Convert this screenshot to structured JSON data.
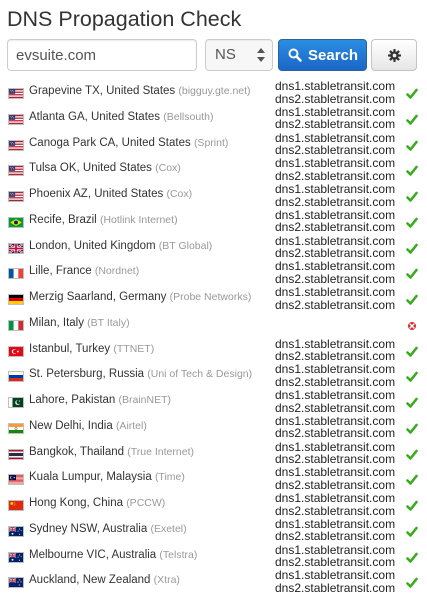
{
  "page": {
    "title": "DNS Propagation Check"
  },
  "search": {
    "domain_value": "evsuite.com",
    "record_type": "NS",
    "search_label": "Search"
  },
  "colors": {
    "check": "#3aab1f",
    "error": "#d32f2f",
    "isp": "#999999",
    "primary": "#2279d2"
  },
  "results": [
    {
      "flag": "us",
      "location": "Grapevine TX, United States",
      "isp": "(bigguy.gte.net)",
      "ns": [
        "dns1.stabletransit.com",
        "dns2.stabletransit.com"
      ],
      "status": "ok",
      "status_icon": "check-icon"
    },
    {
      "flag": "us",
      "location": "Atlanta GA, United States",
      "isp": "(Bellsouth)",
      "ns": [
        "dns1.stabletransit.com",
        "dns2.stabletransit.com"
      ],
      "status": "ok",
      "status_icon": "check-icon"
    },
    {
      "flag": "us",
      "location": "Canoga Park CA, United States",
      "isp": "(Sprint)",
      "ns": [
        "dns1.stabletransit.com",
        "dns2.stabletransit.com"
      ],
      "status": "ok",
      "status_icon": "check-icon"
    },
    {
      "flag": "us",
      "location": "Tulsa OK, United States",
      "isp": "(Cox)",
      "ns": [
        "dns1.stabletransit.com",
        "dns2.stabletransit.com"
      ],
      "status": "ok",
      "status_icon": "check-icon"
    },
    {
      "flag": "us",
      "location": "Phoenix AZ, United States",
      "isp": "(Cox)",
      "ns": [
        "dns1.stabletransit.com",
        "dns2.stabletransit.com"
      ],
      "status": "ok",
      "status_icon": "check-icon"
    },
    {
      "flag": "br",
      "location": "Recife, Brazil",
      "isp": "(Hotlink Internet)",
      "ns": [
        "dns1.stabletransit.com",
        "dns2.stabletransit.com"
      ],
      "status": "ok",
      "status_icon": "check-icon"
    },
    {
      "flag": "gb",
      "location": "London, United Kingdom",
      "isp": "(BT Global)",
      "ns": [
        "dns1.stabletransit.com",
        "dns2.stabletransit.com"
      ],
      "status": "ok",
      "status_icon": "check-icon"
    },
    {
      "flag": "fr",
      "location": "Lille, France",
      "isp": "(Nordnet)",
      "ns": [
        "dns1.stabletransit.com",
        "dns2.stabletransit.com"
      ],
      "status": "ok",
      "status_icon": "check-icon"
    },
    {
      "flag": "de",
      "location": "Merzig Saarland, Germany",
      "isp": "(Probe Networks)",
      "ns": [
        "dns1.stabletransit.com",
        "dns2.stabletransit.com"
      ],
      "status": "ok",
      "status_icon": "check-icon"
    },
    {
      "flag": "it",
      "location": "Milan, Italy",
      "isp": "(BT Italy)",
      "ns": [],
      "status": "error",
      "status_icon": "error-icon"
    },
    {
      "flag": "tr",
      "location": "Istanbul, Turkey",
      "isp": "(TTNET)",
      "ns": [
        "dns1.stabletransit.com",
        "dns2.stabletransit.com"
      ],
      "status": "ok",
      "status_icon": "check-icon"
    },
    {
      "flag": "ru",
      "location": "St. Petersburg, Russia",
      "isp": "(Uni of Tech & Design)",
      "ns": [
        "dns1.stabletransit.com",
        "dns2.stabletransit.com"
      ],
      "status": "ok",
      "status_icon": "check-icon"
    },
    {
      "flag": "pk",
      "location": "Lahore, Pakistan",
      "isp": "(BrainNET)",
      "ns": [
        "dns1.stabletransit.com",
        "dns2.stabletransit.com"
      ],
      "status": "ok",
      "status_icon": "check-icon"
    },
    {
      "flag": "in",
      "location": "New Delhi, India",
      "isp": "(Airtel)",
      "ns": [
        "dns1.stabletransit.com",
        "dns2.stabletransit.com"
      ],
      "status": "ok",
      "status_icon": "check-icon"
    },
    {
      "flag": "th",
      "location": "Bangkok, Thailand",
      "isp": "(True Internet)",
      "ns": [
        "dns1.stabletransit.com",
        "dns2.stabletransit.com"
      ],
      "status": "ok",
      "status_icon": "check-icon"
    },
    {
      "flag": "my",
      "location": "Kuala Lumpur, Malaysia",
      "isp": "(Time)",
      "ns": [
        "dns1.stabletransit.com",
        "dns2.stabletransit.com"
      ],
      "status": "ok",
      "status_icon": "check-icon"
    },
    {
      "flag": "cn",
      "location": "Hong Kong, China",
      "isp": "(PCCW)",
      "ns": [
        "dns1.stabletransit.com",
        "dns2.stabletransit.com"
      ],
      "status": "ok",
      "status_icon": "check-icon"
    },
    {
      "flag": "au",
      "location": "Sydney NSW, Australia",
      "isp": "(Exetel)",
      "ns": [
        "dns1.stabletransit.com",
        "dns2.stabletransit.com"
      ],
      "status": "ok",
      "status_icon": "check-icon"
    },
    {
      "flag": "au",
      "location": "Melbourne VIC, Australia",
      "isp": "(Telstra)",
      "ns": [
        "dns1.stabletransit.com",
        "dns2.stabletransit.com"
      ],
      "status": "ok",
      "status_icon": "check-icon"
    },
    {
      "flag": "nz",
      "location": "Auckland, New Zealand",
      "isp": "(Xtra)",
      "ns": [
        "dns1.stabletransit.com",
        "dns2.stabletransit.com"
      ],
      "status": "ok",
      "status_icon": "check-icon"
    }
  ]
}
